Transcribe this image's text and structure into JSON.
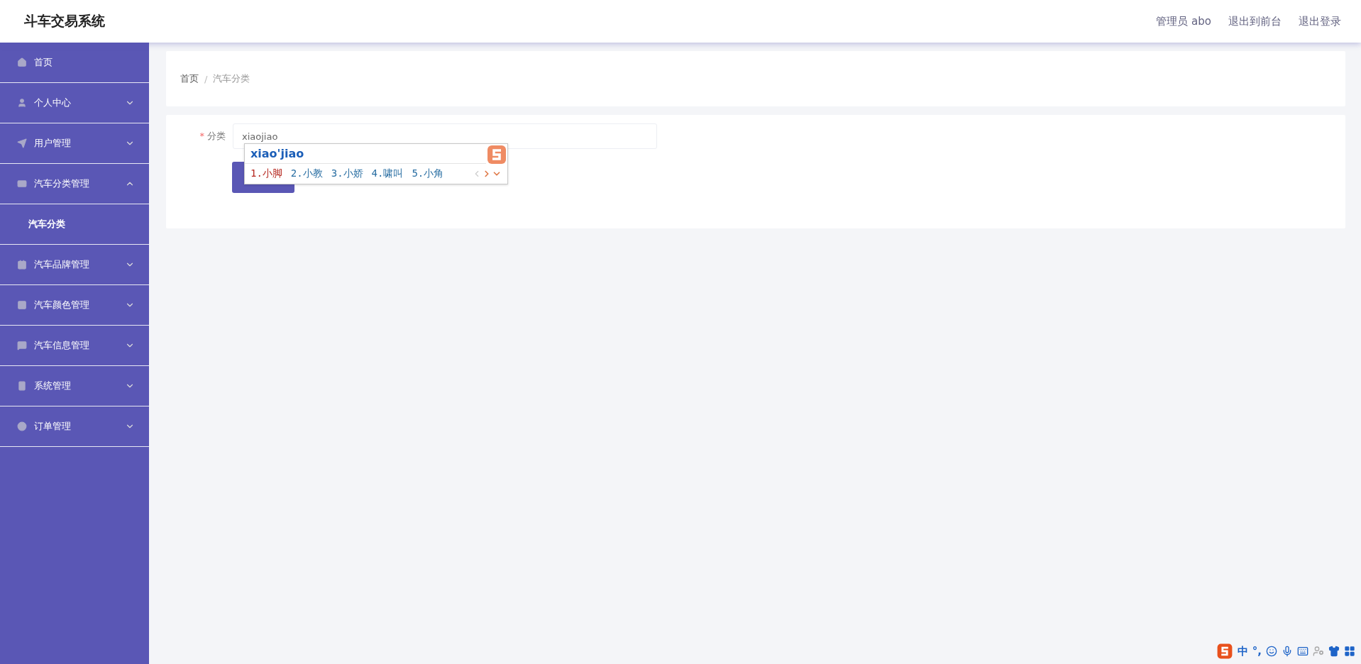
{
  "header": {
    "title": "斗车交易系统",
    "links": [
      "管理员 abo",
      "退出到前台",
      "退出登录"
    ]
  },
  "sidebar": {
    "items": [
      {
        "label": "首页"
      },
      {
        "label": "个人中心",
        "expanded": false
      },
      {
        "label": "用户管理",
        "expanded": false
      },
      {
        "label": "汽车分类管理",
        "expanded": true,
        "children": [
          {
            "label": "汽车分类"
          }
        ]
      },
      {
        "label": "汽车品牌管理",
        "expanded": false
      },
      {
        "label": "汽车颜色管理",
        "expanded": false
      },
      {
        "label": "汽车信息管理",
        "expanded": false
      },
      {
        "label": "系统管理",
        "expanded": false
      },
      {
        "label": "订单管理",
        "expanded": false
      }
    ]
  },
  "breadcrumb": {
    "separator": "/",
    "items": [
      "首页",
      "汽车分类"
    ]
  },
  "form": {
    "field": {
      "label": "分类",
      "required_mark": "*",
      "value": "xiaojiao"
    }
  },
  "ime_popup": {
    "composition": "xiao'jiao",
    "candidates": [
      {
        "label": "1.小脚",
        "selected": true
      },
      {
        "label": "2.小教",
        "selected": false
      },
      {
        "label": "3.小娇",
        "selected": false
      },
      {
        "label": "4.啸叫",
        "selected": false
      },
      {
        "label": "5.小角",
        "selected": false
      }
    ]
  },
  "ime_toolbar": {
    "mode": "中",
    "punctuation": "°,"
  }
}
